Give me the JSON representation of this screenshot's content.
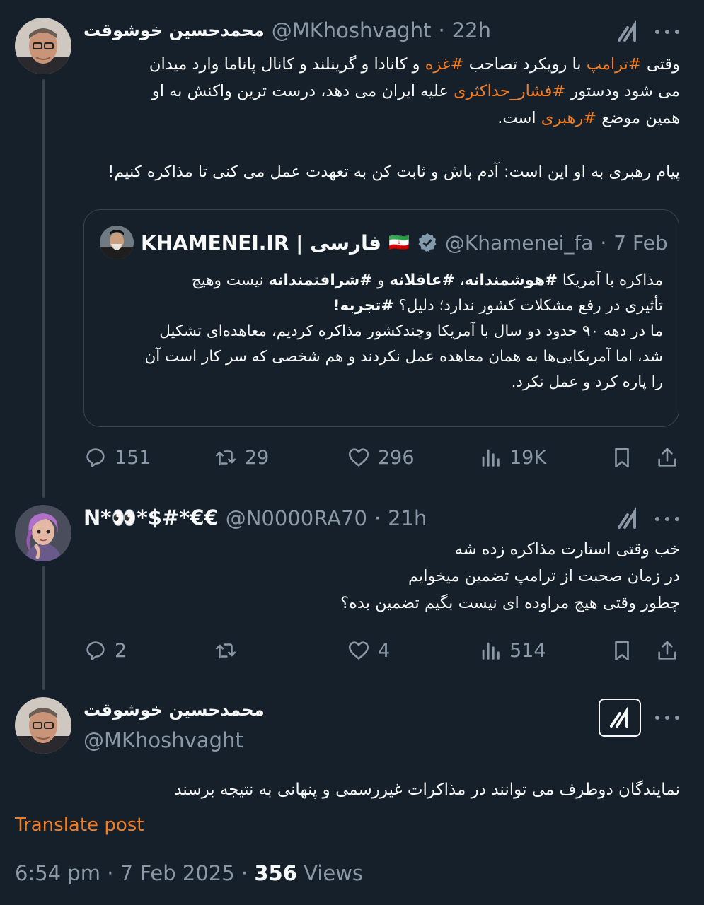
{
  "tweet1": {
    "author_name": "محمدحسین خوشوقت",
    "handle": "@MKhoshvaght",
    "time": "22h",
    "text_segments": [
      [
        "وقتی ",
        ""
      ],
      [
        "#ترامپ",
        "tag"
      ],
      [
        " با رویکرد تصاحب ",
        ""
      ],
      [
        "#غزه",
        "tag"
      ],
      [
        " و کانادا و گرینلند و کانال پاناما وارد میدان",
        ""
      ]
    ],
    "line2_pre": "می شود ودستور ",
    "line2_tag": "#فشار_حداکثری",
    "line2_post": " علیه ایران می دهد، درست ترین واکنش به او",
    "line3_pre": "همین موضع ",
    "line3_tag": "#رهبری",
    "line3_post": " است.",
    "line4": "پیام رهبری به او این است: آدم باش و ثابت کن به تعهدت عمل می کنی تا مذاکره کنیم!",
    "stats": {
      "replies": "151",
      "retweets": "29",
      "likes": "296",
      "views": "19K"
    }
  },
  "quote": {
    "author_name": "KHAMENEI.IR | فارسی",
    "flag": "🇮🇷",
    "handle": "@Khamenei_fa",
    "time": "7 Feb",
    "line1_a": "مذاکره با آمریکا ",
    "line1_b": "#هوشمندانه",
    "line1_c": "، ",
    "line1_d": "#عاقلانه",
    "line1_e": " و ",
    "line1_f": "#شرافتمندانه",
    "line1_g": " نیست وهیچ",
    "line2_a": "تأثیری در رفع مشکلات کشور ندارد؛ دلیل؟ ",
    "line2_b": "#تجربه!",
    "line3": "ما در دهه ۹۰ حدود دو سال با آمریکا وچندکشور مذاکره کردیم، معاهده‌ای تشکیل",
    "line4": "شد، اما آمریکایی‌ها به همان معاهده عمل نکردند و هم شخصی که سر کار است آن",
    "line5": "را پاره کرد و عمل نکرد."
  },
  "tweet2": {
    "author_name": "N*👀*$#*€€",
    "handle": "@N0000RA70",
    "time": "21h",
    "line1": "خب وقتی استارت مذاکره زده شه",
    "line2": "در زمان صحبت از ترامپ تضمین میخوایم",
    "line3": "چطور وقتی هیچ مراوده ای نیست بگیم تضمین بده؟",
    "stats": {
      "replies": "2",
      "retweets": "",
      "likes": "4",
      "views": "514"
    }
  },
  "tweet3": {
    "author_name": "محمدحسین خوشوقت",
    "handle": "@MKhoshvaght",
    "text": "نمایندگان دوطرف می توانند در مذاکرات غیررسمی و پنهانی به نتیجه برسند",
    "translate_label": "Translate post",
    "timestamp": "6:54 pm · 7 Feb 2025 · ",
    "views_count": "356",
    "views_label": " Views"
  },
  "icons": {
    "reply": "reply-icon",
    "retweet": "retweet-icon",
    "like": "heart-icon",
    "views": "views-icon",
    "bookmark": "bookmark-icon",
    "share": "share-icon",
    "grok": "grok-icon",
    "more": "more-icon",
    "verified": "verified-icon"
  },
  "colors": {
    "background": "#15202b",
    "accent": "#f47c20",
    "muted": "#8b98a5",
    "border": "#38444d"
  }
}
